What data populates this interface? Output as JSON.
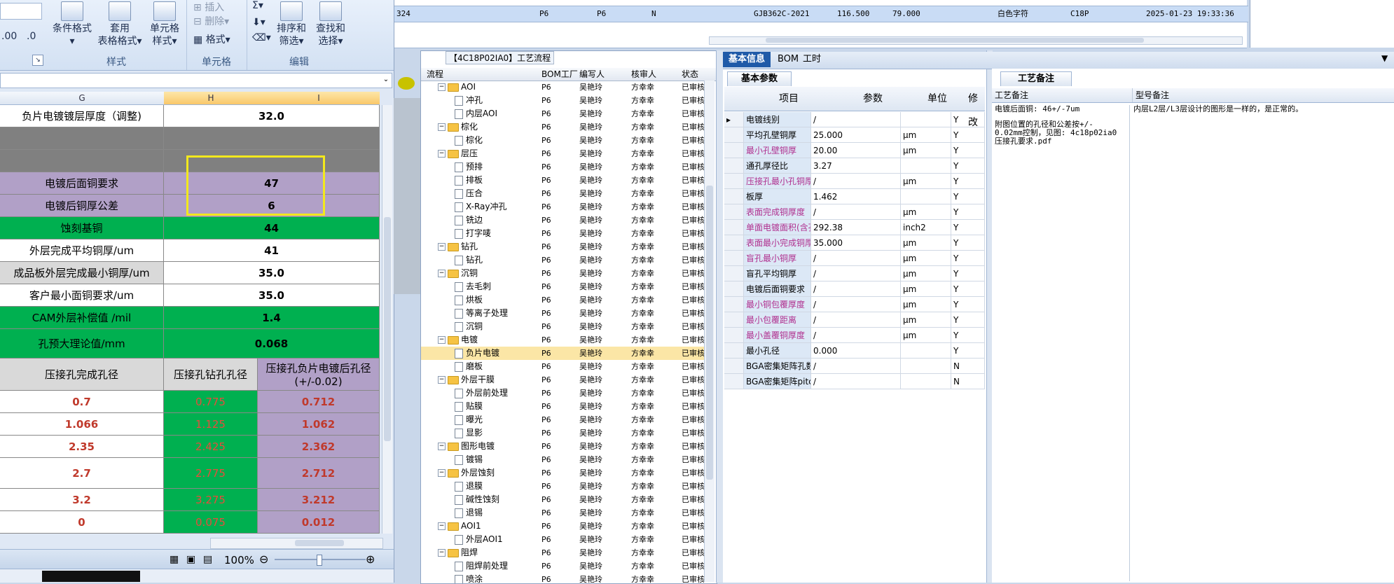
{
  "excel": {
    "ribbon": {
      "styles_group": "样式",
      "cells_group": "单元格",
      "edit_group": "编辑",
      "cond_format": "条件格式",
      "cond_format_arrow": "▾",
      "apply_table": "套用",
      "table_format": "表格格式▾",
      "cell_style": "单元格",
      "cell_style2": "样式▾",
      "insert": "插入",
      "delete": "删除▾",
      "format": "格式▾",
      "sigma": "Σ▾",
      "sort_filter": "排序和",
      "sort_filter2": "筛选▾",
      "find_select": "查找和",
      "find_select2": "选择▾",
      "num1": ".00",
      "num2": ".0"
    },
    "columns": [
      "G",
      "H",
      "I"
    ],
    "rows": [
      {
        "g": "负片电镀镀层厚度（调整)",
        "hi": "32.0"
      },
      {
        "g": "",
        "hi": ""
      },
      {
        "g": "",
        "hi": ""
      },
      {
        "g": "电镀后面铜要求",
        "hi": "47"
      },
      {
        "g": "电镀后铜厚公差",
        "hi": "6"
      },
      {
        "g": "蚀刻基铜",
        "hi": "44"
      },
      {
        "g": "外层完成平均铜厚/um",
        "hi": "41"
      },
      {
        "g": "成品板外层完成最小铜厚/um",
        "hi": "35.0"
      },
      {
        "g": "客户最小面铜要求/um",
        "hi": "35.0"
      },
      {
        "g": "CAM外层补偿值 /mil",
        "hi": "1.4"
      },
      {
        "g": "孔预大理论值/mm",
        "hi": "0.068"
      }
    ],
    "hole_header": {
      "g": "压接孔完成孔径",
      "h": "压接孔钻孔孔径",
      "i": "压接孔负片电镀后孔径",
      "i2": "(+/-0.02)"
    },
    "hole_rows": [
      {
        "g": "0.7",
        "h": "0.775",
        "i": "0.712"
      },
      {
        "g": "1.066",
        "h": "1.125",
        "i": "1.062"
      },
      {
        "g": "2.35",
        "h": "2.425",
        "i": "2.362"
      },
      {
        "g": "2.7",
        "h": "2.775",
        "i": "2.712"
      },
      {
        "g": "3.2",
        "h": "3.275",
        "i": "3.212"
      },
      {
        "g": "0",
        "h": "0.075",
        "i": "0.012"
      }
    ],
    "zoom": "100%"
  },
  "top_row": [
    "324",
    "P6",
    "P6",
    "N",
    "GJB362C-2021",
    "116.500",
    "79.000",
    "白色字符",
    "C18P",
    "2025-01-23 19:33:36"
  ],
  "tree": {
    "title": "【4C18P02IA0】工艺流程",
    "headers": [
      "流程",
      "BOM工厂",
      "编写人",
      "核审人",
      "状态"
    ],
    "rows": [
      {
        "level": 1,
        "name": "AOI",
        "p": "P6",
        "w": "吴艳玲",
        "a": "方幸幸",
        "s": "已审核"
      },
      {
        "level": 2,
        "name": "冲孔",
        "p": "P6",
        "w": "吴艳玲",
        "a": "方幸幸",
        "s": "已审核"
      },
      {
        "level": 2,
        "name": "内层AOI",
        "p": "P6",
        "w": "吴艳玲",
        "a": "方幸幸",
        "s": "已审核"
      },
      {
        "level": 1,
        "name": "棕化",
        "p": "P6",
        "w": "吴艳玲",
        "a": "方幸幸",
        "s": "已审核"
      },
      {
        "level": 2,
        "name": "棕化",
        "p": "P6",
        "w": "吴艳玲",
        "a": "方幸幸",
        "s": "已审核"
      },
      {
        "level": 1,
        "name": "层压",
        "p": "P6",
        "w": "吴艳玲",
        "a": "方幸幸",
        "s": "已审核"
      },
      {
        "level": 2,
        "name": "预排",
        "p": "P6",
        "w": "吴艳玲",
        "a": "方幸幸",
        "s": "已审核"
      },
      {
        "level": 2,
        "name": "排板",
        "p": "P6",
        "w": "吴艳玲",
        "a": "方幸幸",
        "s": "已审核"
      },
      {
        "level": 2,
        "name": "压合",
        "p": "P6",
        "w": "吴艳玲",
        "a": "方幸幸",
        "s": "已审核"
      },
      {
        "level": 2,
        "name": "X-Ray冲孔",
        "p": "P6",
        "w": "吴艳玲",
        "a": "方幸幸",
        "s": "已审核"
      },
      {
        "level": 2,
        "name": "铣边",
        "p": "P6",
        "w": "吴艳玲",
        "a": "方幸幸",
        "s": "已审核"
      },
      {
        "level": 2,
        "name": "打字唛",
        "p": "P6",
        "w": "吴艳玲",
        "a": "方幸幸",
        "s": "已审核"
      },
      {
        "level": 1,
        "name": "钻孔",
        "p": "P6",
        "w": "吴艳玲",
        "a": "方幸幸",
        "s": "已审核"
      },
      {
        "level": 2,
        "name": "钻孔",
        "p": "P6",
        "w": "吴艳玲",
        "a": "方幸幸",
        "s": "已审核"
      },
      {
        "level": 1,
        "name": "沉铜",
        "p": "P6",
        "w": "吴艳玲",
        "a": "方幸幸",
        "s": "已审核"
      },
      {
        "level": 2,
        "name": "去毛刺",
        "p": "P6",
        "w": "吴艳玲",
        "a": "方幸幸",
        "s": "已审核"
      },
      {
        "level": 2,
        "name": "烘板",
        "p": "P6",
        "w": "吴艳玲",
        "a": "方幸幸",
        "s": "已审核"
      },
      {
        "level": 2,
        "name": "等离子处理",
        "p": "P6",
        "w": "吴艳玲",
        "a": "方幸幸",
        "s": "已审核"
      },
      {
        "level": 2,
        "name": "沉铜",
        "p": "P6",
        "w": "吴艳玲",
        "a": "方幸幸",
        "s": "已审核"
      },
      {
        "level": 1,
        "name": "电镀",
        "p": "P6",
        "w": "吴艳玲",
        "a": "方幸幸",
        "s": "已审核"
      },
      {
        "level": 2,
        "name": "负片电镀",
        "p": "P6",
        "w": "吴艳玲",
        "a": "方幸幸",
        "s": "已审核",
        "sel": true
      },
      {
        "level": 2,
        "name": "磨板",
        "p": "P6",
        "w": "吴艳玲",
        "a": "方幸幸",
        "s": "已审核"
      },
      {
        "level": 1,
        "name": "外层干膜",
        "p": "P6",
        "w": "吴艳玲",
        "a": "方幸幸",
        "s": "已审核"
      },
      {
        "level": 2,
        "name": "外层前处理",
        "p": "P6",
        "w": "吴艳玲",
        "a": "方幸幸",
        "s": "已审核"
      },
      {
        "level": 2,
        "name": "贴膜",
        "p": "P6",
        "w": "吴艳玲",
        "a": "方幸幸",
        "s": "已审核"
      },
      {
        "level": 2,
        "name": "曝光",
        "p": "P6",
        "w": "吴艳玲",
        "a": "方幸幸",
        "s": "已审核"
      },
      {
        "level": 2,
        "name": "显影",
        "p": "P6",
        "w": "吴艳玲",
        "a": "方幸幸",
        "s": "已审核"
      },
      {
        "level": 1,
        "name": "图形电镀",
        "p": "P6",
        "w": "吴艳玲",
        "a": "方幸幸",
        "s": "已审核"
      },
      {
        "level": 2,
        "name": "镀锡",
        "p": "P6",
        "w": "吴艳玲",
        "a": "方幸幸",
        "s": "已审核"
      },
      {
        "level": 1,
        "name": "外层蚀刻",
        "p": "P6",
        "w": "吴艳玲",
        "a": "方幸幸",
        "s": "已审核"
      },
      {
        "level": 2,
        "name": "退膜",
        "p": "P6",
        "w": "吴艳玲",
        "a": "方幸幸",
        "s": "已审核"
      },
      {
        "level": 2,
        "name": "碱性蚀刻",
        "p": "P6",
        "w": "吴艳玲",
        "a": "方幸幸",
        "s": "已审核"
      },
      {
        "level": 2,
        "name": "退锡",
        "p": "P6",
        "w": "吴艳玲",
        "a": "方幸幸",
        "s": "已审核"
      },
      {
        "level": 1,
        "name": "AOI1",
        "p": "P6",
        "w": "吴艳玲",
        "a": "方幸幸",
        "s": "已审核"
      },
      {
        "level": 2,
        "name": "外层AOI1",
        "p": "P6",
        "w": "吴艳玲",
        "a": "方幸幸",
        "s": "已审核"
      },
      {
        "level": 1,
        "name": "阻焊",
        "p": "P6",
        "w": "吴艳玲",
        "a": "方幸幸",
        "s": "已审核"
      },
      {
        "level": 2,
        "name": "阻焊前处理",
        "p": "P6",
        "w": "吴艳玲",
        "a": "方幸幸",
        "s": "已审核"
      },
      {
        "level": 2,
        "name": "喷涂",
        "p": "P6",
        "w": "吴艳玲",
        "a": "方幸幸",
        "s": "已审核"
      }
    ]
  },
  "info": {
    "tabs": [
      "基本信息",
      "BOM",
      "工时"
    ],
    "subtab": "基本参数",
    "headers": [
      "项目",
      "参数",
      "单位",
      "修改"
    ],
    "rows": [
      {
        "name": "电镀线别",
        "val": "/",
        "unit": "",
        "mod": "Y",
        "pink": false
      },
      {
        "name": "平均孔壁铜厚",
        "val": "25.000",
        "unit": "μm",
        "mod": "Y",
        "pink": false
      },
      {
        "name": "最小孔壁铜厚",
        "val": "20.00",
        "unit": "μm",
        "mod": "Y",
        "pink": true
      },
      {
        "name": "通孔厚径比",
        "val": "3.27",
        "unit": "",
        "mod": "Y",
        "pink": false
      },
      {
        "name": "压接孔最小孔铜厚",
        "val": "/",
        "unit": "μm",
        "mod": "Y",
        "pink": true
      },
      {
        "name": "板厚",
        "val": "1.462",
        "unit": "",
        "mod": "Y",
        "pink": false
      },
      {
        "name": "表面完成铜厚度",
        "val": "/",
        "unit": "μm",
        "mod": "Y",
        "pink": true
      },
      {
        "name": "单面电镀面积(含孔)",
        "val": "292.38",
        "unit": "inch2",
        "mod": "Y",
        "pink": true
      },
      {
        "name": "表面最小完成铜厚",
        "val": "35.000",
        "unit": "μm",
        "mod": "Y",
        "pink": true
      },
      {
        "name": "盲孔最小铜厚",
        "val": "/",
        "unit": "μm",
        "mod": "Y",
        "pink": true
      },
      {
        "name": "盲孔平均铜厚",
        "val": "/",
        "unit": "μm",
        "mod": "Y",
        "pink": false
      },
      {
        "name": "电镀后面铜要求",
        "val": "/",
        "unit": "μm",
        "mod": "Y",
        "pink": false
      },
      {
        "name": "最小铜包覆厚度",
        "val": "/",
        "unit": "μm",
        "mod": "Y",
        "pink": true
      },
      {
        "name": "最小包覆距离",
        "val": "/",
        "unit": "μm",
        "mod": "Y",
        "pink": true
      },
      {
        "name": "最小盖覆铜厚度",
        "val": "/",
        "unit": "μm",
        "mod": "Y",
        "pink": true
      },
      {
        "name": "最小孔径",
        "val": "0.000",
        "unit": "",
        "mod": "Y",
        "pink": false
      },
      {
        "name": "BGA密集矩阵孔数",
        "val": "/",
        "unit": "",
        "mod": "N",
        "pink": false
      },
      {
        "name": "BGA密集矩阵pitch",
        "val": "/",
        "unit": "",
        "mod": "N",
        "pink": false
      }
    ]
  },
  "notes": {
    "tab": "工艺备注",
    "col1": "工艺备注",
    "col2": "型号备注",
    "text1_a": "电镀后面铜: 46+/-7um",
    "text1_b": "附图位置的孔径和公差按+/-",
    "text1_c": "0.02mm控制，见图: 4c18p02ia0",
    "text1_d": "压接孔要求.pdf",
    "text2": "内层L2层/L3层设计的图形是一样的，是正常的。"
  }
}
